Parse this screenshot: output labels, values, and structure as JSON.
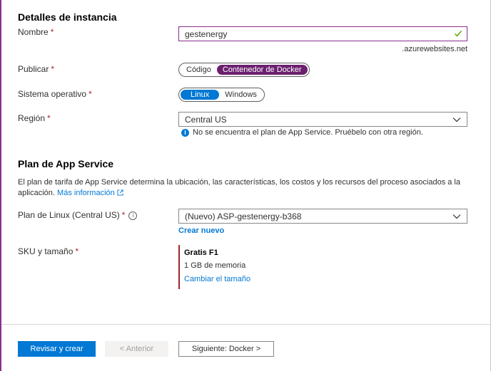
{
  "instance": {
    "title": "Detalles de instancia",
    "name_label": "Nombre",
    "name_value": "gestenergy",
    "name_suffix": ".azurewebsites.net",
    "publish_label": "Publicar",
    "publish_options": [
      "Código",
      "Contenedor de Docker"
    ],
    "publish_selected": "Contenedor de Docker",
    "os_label": "Sistema operativo",
    "os_options": [
      "Linux",
      "Windows"
    ],
    "os_selected": "Linux",
    "region_label": "Región",
    "region_value": "Central US",
    "region_info": "No se encuentra el plan de App Service. Pruébelo con otra región."
  },
  "plan": {
    "title": "Plan de App Service",
    "description": "El plan de tarifa de App Service determina la ubicación, las características, los costos y los recursos del proceso asociados a la aplicación.",
    "more_info_link": "Más información",
    "linux_plan_label": "Plan de Linux (Central US)",
    "linux_plan_value": "(Nuevo) ASP-gestenergy-b368",
    "create_new_link": "Crear nuevo",
    "sku_label": "SKU y tamaño",
    "sku_name": "Gratis F1",
    "sku_memory": "1 GB de memoria",
    "sku_change_link": "Cambiar el tamaño"
  },
  "footer": {
    "review_button": "Revisar y crear",
    "previous_button": "< Anterior",
    "next_button": "Siguiente: Docker >"
  },
  "colors": {
    "accent_purple": "#6b1f6e",
    "accent_blue": "#0078d4",
    "required_red": "#a4262c",
    "valid_green": "#57a300"
  }
}
